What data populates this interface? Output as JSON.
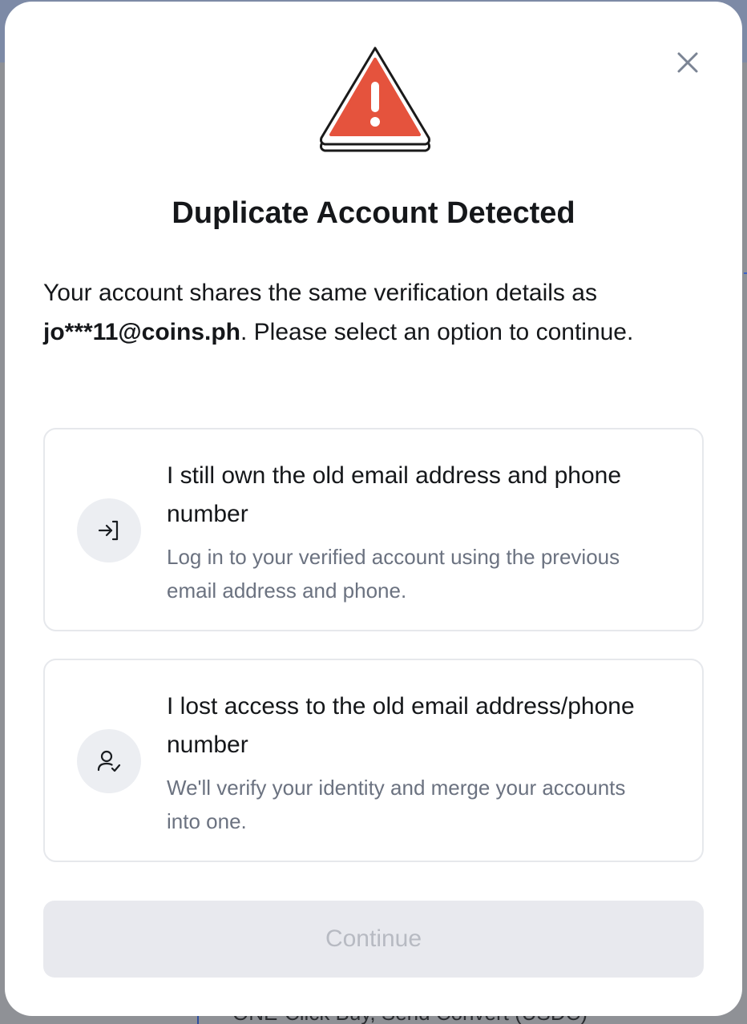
{
  "background": {
    "partial_text": "ONE-Click Buy, Send Convert (USDC)"
  },
  "modal": {
    "close_icon": "close-icon",
    "warning_icon": "warning-triangle-icon",
    "title": "Duplicate Account Detected",
    "message_prefix": "Your account shares the same verification details as ",
    "message_email": "jo***11@coins.ph",
    "message_suffix": ". Please select an option to continue.",
    "options": [
      {
        "icon": "login-arrow-icon",
        "title": "I still own the old email address and phone number",
        "description": "Log in to your verified account using the previous email address and phone."
      },
      {
        "icon": "user-check-icon",
        "title": "I lost access to the old email address/phone number",
        "description": "We'll verify your identity and merge your accounts into one."
      }
    ],
    "continue_label": "Continue",
    "continue_state": "disabled"
  },
  "colors": {
    "warning_red": "#e5533d",
    "title_text": "#15171a",
    "muted_text": "#6b7280",
    "disabled_bg": "#e8e9ee",
    "disabled_text": "#b7bac2"
  }
}
